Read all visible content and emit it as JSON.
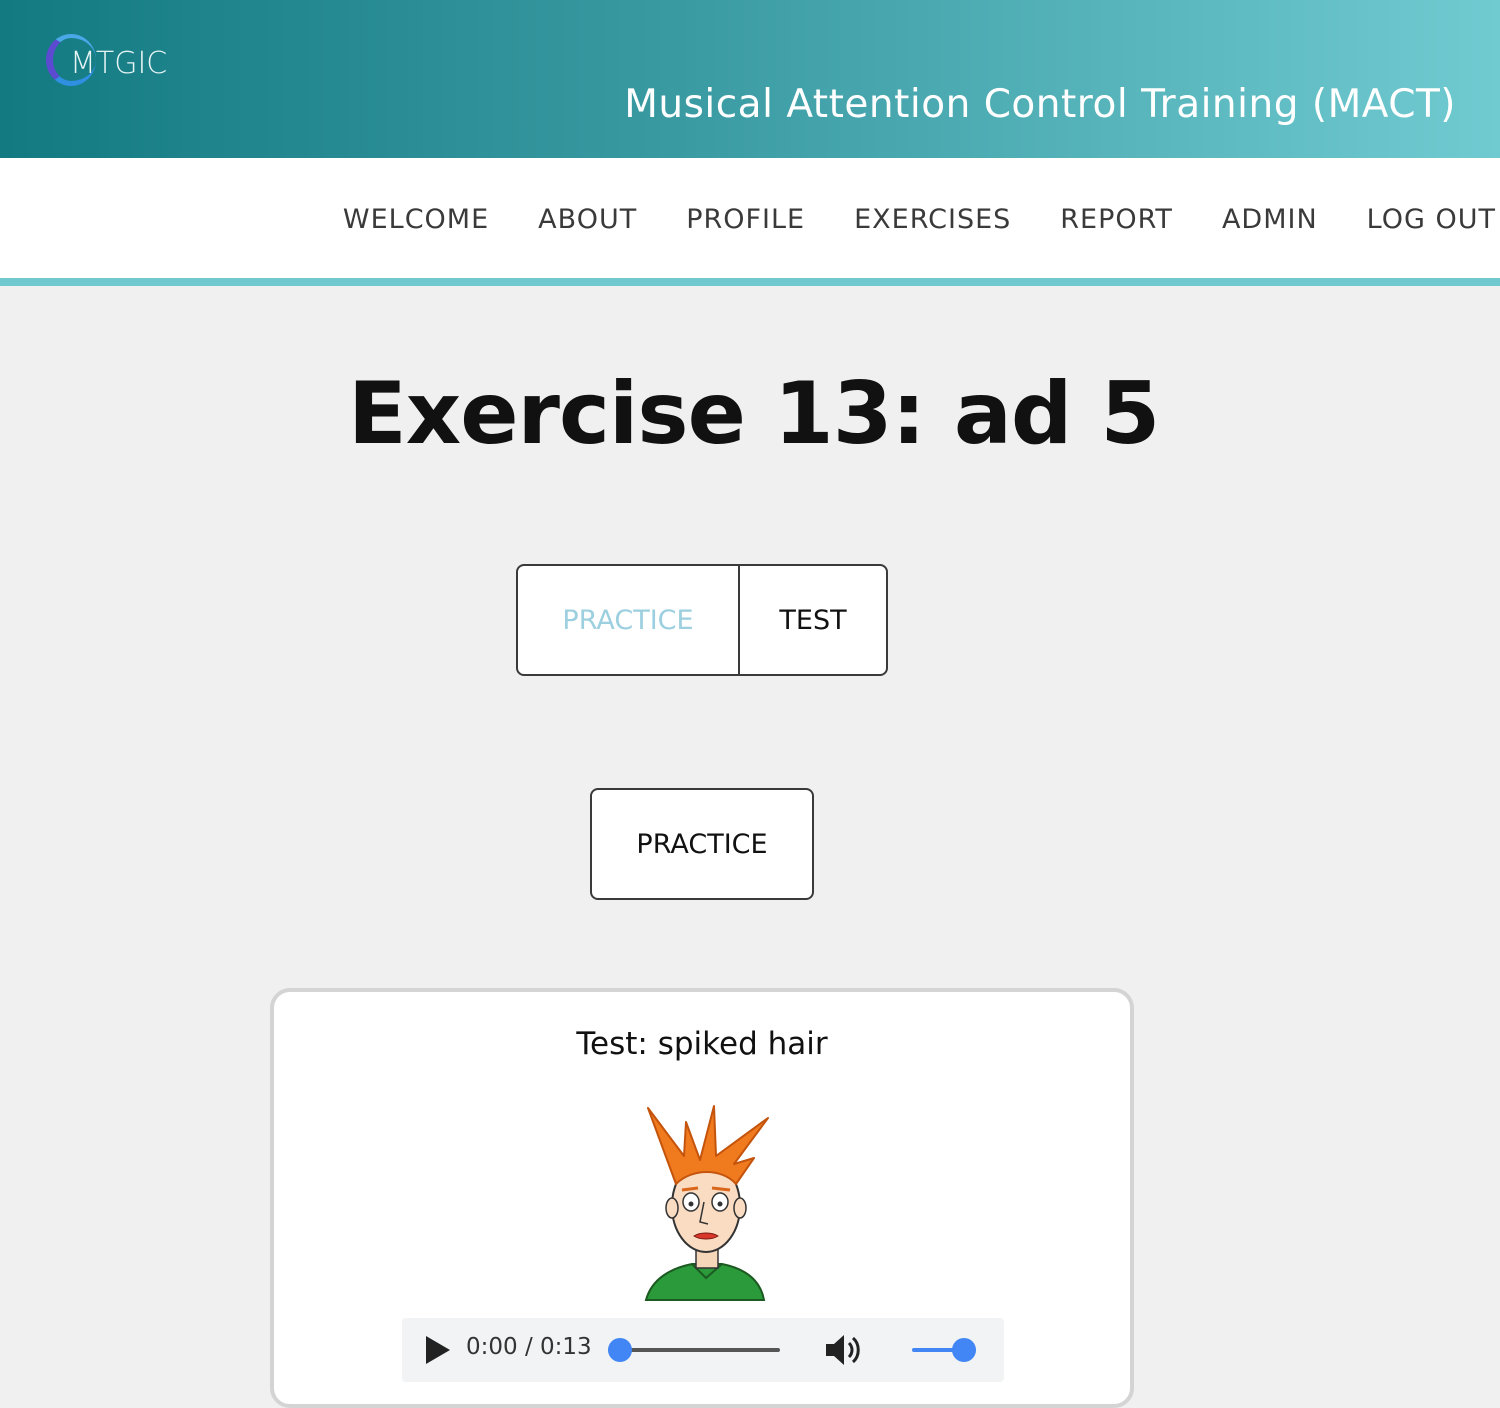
{
  "header": {
    "logo_text": "MTGIC",
    "site_title": "Musical Attention Control Training (MACT)"
  },
  "nav": {
    "items": [
      "WELCOME",
      "ABOUT",
      "PROFILE",
      "EXERCISES",
      "REPORT",
      "ADMIN",
      "LOG OUT"
    ]
  },
  "page": {
    "title": "Exercise 13: ad 5"
  },
  "mode_toggle": {
    "practice_label": "PRACTICE",
    "test_label": "TEST",
    "active": "PRACTICE"
  },
  "practice_button": {
    "label": "PRACTICE"
  },
  "card": {
    "title": "Test: spiked hair",
    "audio": {
      "current_time": "0:00",
      "duration": "0:13",
      "time_display": "0:00 / 0:13",
      "progress": 0.0,
      "volume": 1.0
    }
  },
  "colors": {
    "header_gradient_start": "#137a82",
    "header_gradient_end": "#70cbd1",
    "nav_accent": "#6fc9cf",
    "toggle_active_text": "#9ccfdf",
    "player_accent": "#4285f4"
  }
}
